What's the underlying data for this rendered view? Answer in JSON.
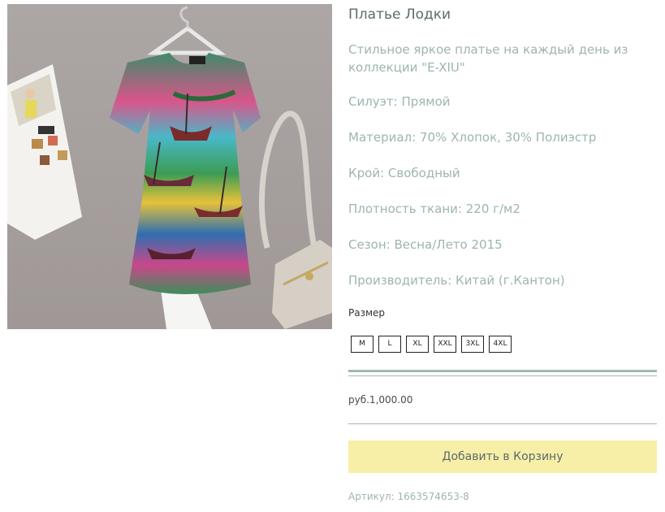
{
  "product": {
    "image_alt": "Платье Лодки",
    "title": "Платье Лодки",
    "description": "Стильное яркое платье на каждый день из коллекции \"E-XIU\"",
    "attributes": [
      "Силуэт: Прямой",
      "Материал: 70% Хлопок, 30% Полиэстр",
      "Крой: Свободный",
      "Плотность ткани: 220 г/м2",
      "Сезон: Весна/Лето 2015",
      "Производитель: Китай (г.Кантон)"
    ],
    "size_label": "Размер",
    "sizes": [
      "M",
      "L",
      "XL",
      "XXL",
      "3XL",
      "4XL"
    ],
    "price": "руб.1,000.00",
    "add_to_cart": "Добавить в Корзину",
    "sku": "Артикул: 1663574653-8"
  },
  "colors": {
    "title_text": "#5d6b6b",
    "body_text": "#9eb5b0",
    "rule": "#a3b7b2",
    "cart_button_bg": "#f7efa8"
  }
}
